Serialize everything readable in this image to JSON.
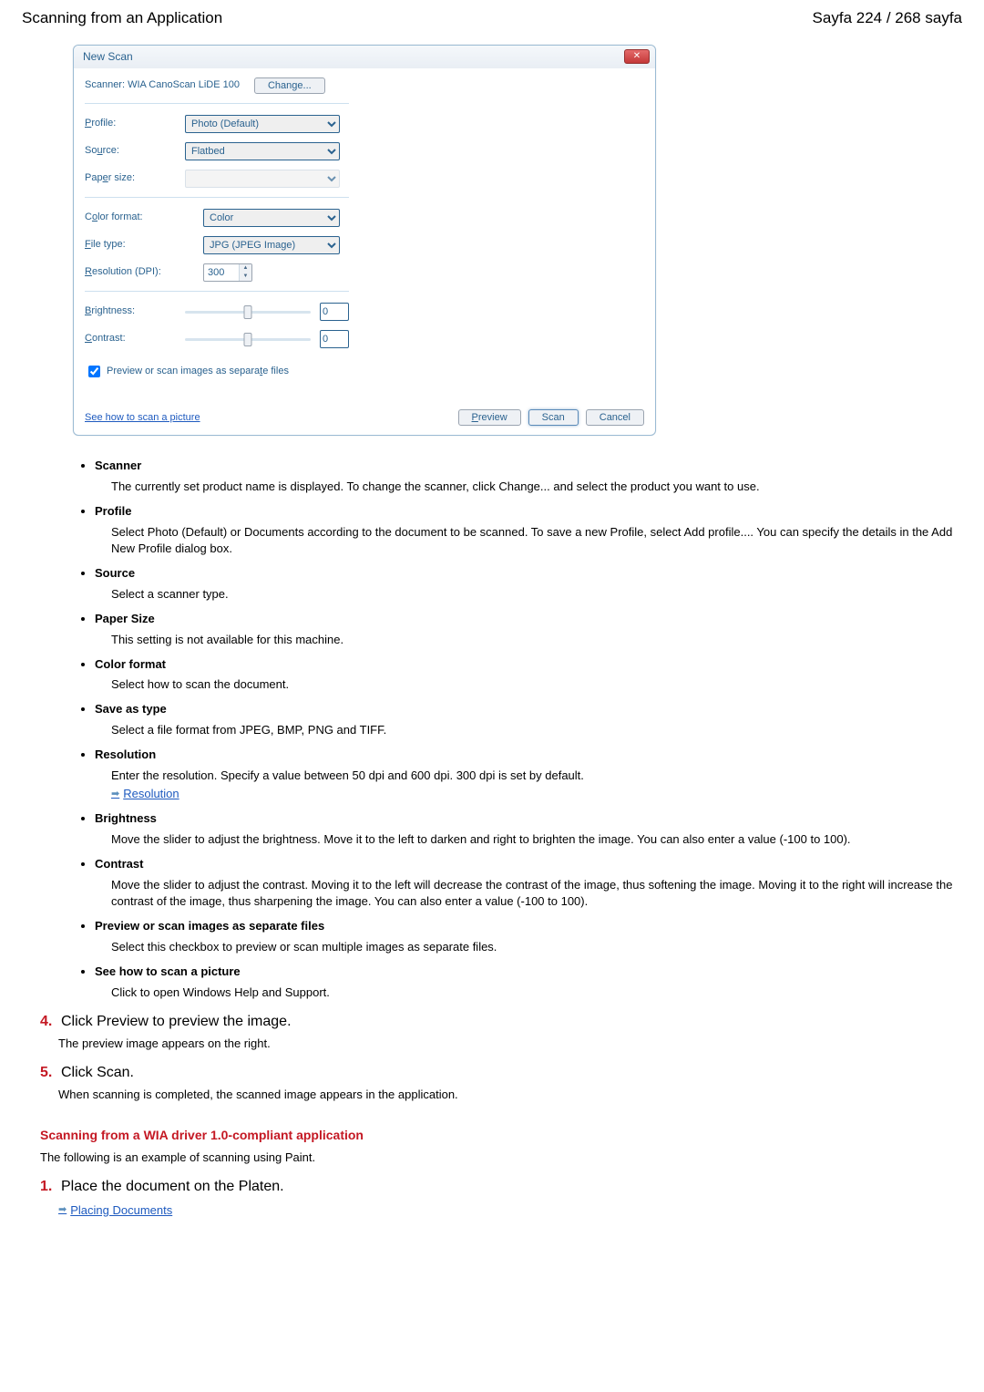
{
  "header": {
    "title": "Scanning from an Application",
    "page": "Sayfa 224 / 268 sayfa"
  },
  "dialog": {
    "title": "New Scan",
    "scanner_label": "Scanner: WIA CanoScan LiDE 100",
    "change_btn": "Change...",
    "profile_label": "Profile:",
    "profile_value": "Photo (Default)",
    "source_label": "Source:",
    "source_value": "Flatbed",
    "papersize_label": "Paper size:",
    "papersize_value": "",
    "colorformat_label": "Color format:",
    "colorformat_value": "Color",
    "filetype_label": "File type:",
    "filetype_value": "JPG (JPEG Image)",
    "resolution_label": "Resolution (DPI):",
    "resolution_value": "300",
    "brightness_label": "Brightness:",
    "brightness_value": "0",
    "contrast_label": "Contrast:",
    "contrast_value": "0",
    "separate_files_label": "Preview or scan images as separate files",
    "howto_link": "See how to scan a picture",
    "preview_btn": "Preview",
    "scan_btn": "Scan",
    "cancel_btn": "Cancel"
  },
  "defs": [
    {
      "term": "Scanner",
      "desc": "The currently set product name is displayed. To change the scanner, click Change... and select the product you want to use."
    },
    {
      "term": "Profile",
      "desc": "Select Photo (Default) or Documents according to the document to be scanned. To save a new Profile, select Add profile.... You can specify the details in the Add New Profile dialog box."
    },
    {
      "term": "Source",
      "desc": "Select a scanner type."
    },
    {
      "term": "Paper Size",
      "desc": "This setting is not available for this machine."
    },
    {
      "term": "Color format",
      "desc": "Select how to scan the document."
    },
    {
      "term": "Save as type",
      "desc": "Select a file format from JPEG, BMP, PNG and TIFF."
    },
    {
      "term": "Resolution",
      "desc": "Enter the resolution. Specify a value between 50 dpi and 600 dpi. 300 dpi is set by default.",
      "link": "Resolution"
    },
    {
      "term": "Brightness",
      "desc": "Move the slider to adjust the brightness. Move it to the left to darken and right to brighten the image. You can also enter a value (-100 to 100)."
    },
    {
      "term": "Contrast",
      "desc": "Move the slider to adjust the contrast. Moving it to the left will decrease the contrast of the image, thus softening the image. Moving it to the right will increase the contrast of the image, thus sharpening the image. You can also enter a value (-100 to 100)."
    },
    {
      "term": "Preview or scan images as separate files",
      "desc": "Select this checkbox to preview or scan multiple images as separate files."
    },
    {
      "term": "See how to scan a picture",
      "desc": "Click to open Windows Help and Support."
    }
  ],
  "steps": {
    "s4": {
      "num": "4.",
      "text": "Click Preview to preview the image.",
      "desc": "The preview image appears on the right."
    },
    "s5": {
      "num": "5.",
      "text": "Click Scan.",
      "desc": "When scanning is completed, the scanned image appears in the application."
    }
  },
  "section2": {
    "title": "Scanning from a WIA driver 1.0-compliant application",
    "desc": "The following is an example of scanning using Paint.",
    "s1": {
      "num": "1.",
      "text": "Place the document on the Platen.",
      "link": "Placing Documents"
    }
  }
}
